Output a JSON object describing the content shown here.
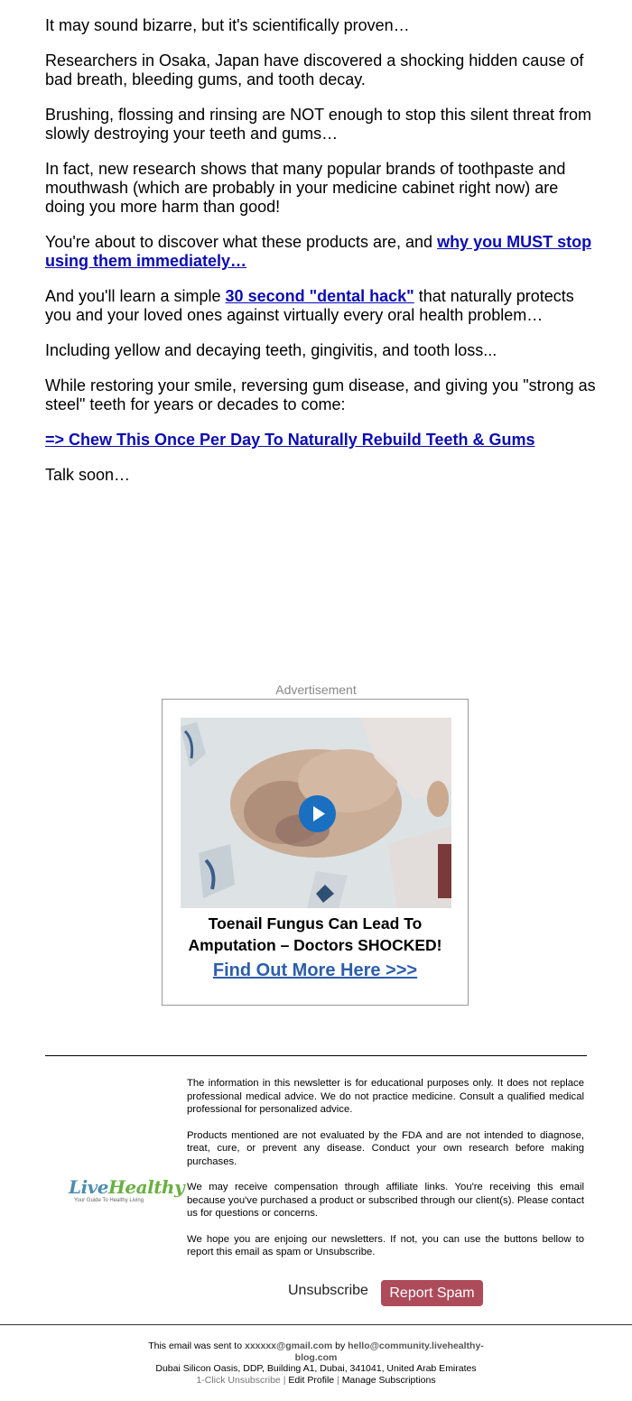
{
  "body": {
    "p1": "It may sound bizarre, but it's scientifically proven…",
    "p2": "Researchers in Osaka, Japan have discovered a shocking hidden cause of bad breath, bleeding gums, and tooth decay.",
    "p3": "Brushing, flossing and rinsing are NOT enough to stop this silent threat from slowly destroying your teeth and gums…",
    "p4": "In fact, new research shows that many popular brands of toothpaste and mouthwash (which are probably in your medicine cabinet right now) are doing you more harm than good!",
    "p5_text": "You're about to discover what these products are, and ",
    "p5_link": "why you MUST stop using them immediately…",
    "p6_text_a": "And you'll learn a simple ",
    "p6_link": "30 second \"dental hack\"",
    "p6_text_b": " that naturally protects you and your loved ones against virtually every oral health problem…",
    "p7": "Including yellow and decaying teeth, gingivitis, and tooth loss...",
    "p8": "While restoring your smile, reversing gum disease, and giving you \"strong as steel\" teeth for years or decades to come:",
    "cta_link": "=> Chew This Once Per Day To Naturally Rebuild Teeth & Gums",
    "signoff": "Talk soon…"
  },
  "ad": {
    "label": "Advertisement",
    "title_line1": "Toenail Fungus Can Lead To",
    "title_line2": "Amputation – Doctors SHOCKED!",
    "link": "Find Out More Here >>>"
  },
  "logo": {
    "word1": "Live",
    "word2": "Healthy",
    "tagline": "Your Guide To Healthy Living"
  },
  "disclaimer": [
    "The information in this newsletter is for educational purposes only. It does not replace professional medical advice. We do not practice medicine. Consult a qualified medical professional for personalized advice.",
    "Products mentioned are not evaluated by the FDA and are not intended to diagnose, treat, cure, or prevent any disease. Conduct your own research before making purchases.",
    "We may receive compensation through affiliate links. You're receiving this email because you've purchased a product or subscribed through our client(s). Please contact us for questions or concerns.",
    "We hope you are enjoing our newsletters. If not, you can use the buttons bellow to report this email as spam or Unsubscribe."
  ],
  "actions": {
    "unsubscribe": "Unsubscribe",
    "report_spam": "Report Spam"
  },
  "footer": {
    "sent_prefix": "This email was sent to ",
    "recipient": "xxxxxx@gmail.com",
    "by": " by ",
    "sender": "hello@community.livehealthy-blog.com",
    "address": "Dubai Silicon Oasis, DDP, Building A1, Dubai, 341041, United Arab Emirates",
    "one_click": "1-Click Unsubscribe",
    "sep": " | ",
    "edit_profile": "Edit Profile",
    "manage": "Manage Subscriptions"
  },
  "colors": {
    "link": "#0b0bb3",
    "ad_link": "#2c5eab",
    "spam_button": "#ad4b5b",
    "play_button": "#1a6fc0"
  }
}
